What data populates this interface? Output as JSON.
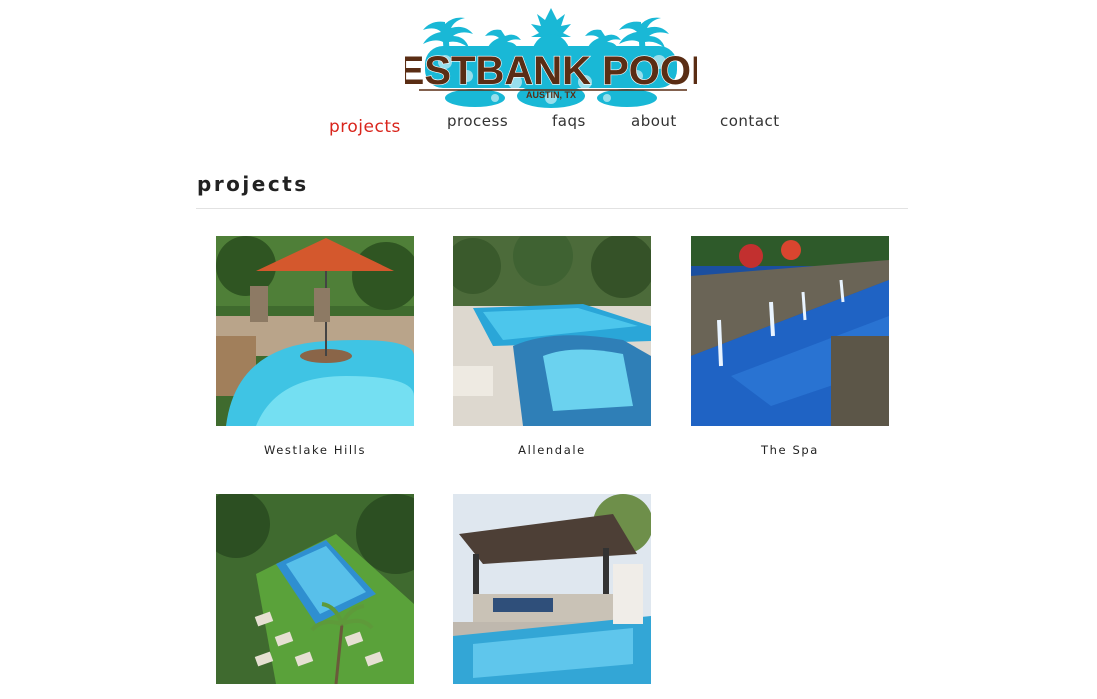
{
  "site": {
    "logo_text": "WESTBANK POOLS",
    "logo_subtext": "AUSTIN, TX"
  },
  "colors": {
    "logo_brown": "#5a2d14",
    "logo_aqua": "#19b8d6",
    "nav_active": "#d9251c",
    "text": "#222222"
  },
  "nav": {
    "items": [
      {
        "label": "projects",
        "active": true
      },
      {
        "label": "process",
        "active": false
      },
      {
        "label": "faqs",
        "active": false
      },
      {
        "label": "about",
        "active": false
      },
      {
        "label": "contact",
        "active": false
      }
    ]
  },
  "page": {
    "title": "projects"
  },
  "projects": [
    {
      "caption": "Westlake Hills",
      "image": "pool-with-umbrella-photo"
    },
    {
      "caption": "Allendale",
      "image": "pool-with-spa-photo"
    },
    {
      "caption": "The Spa",
      "image": "lap-pool-fountains-photo"
    },
    {
      "caption": "",
      "image": "pool-with-grass-pavers-photo"
    },
    {
      "caption": "",
      "image": "pool-with-pavilion-photo"
    }
  ]
}
